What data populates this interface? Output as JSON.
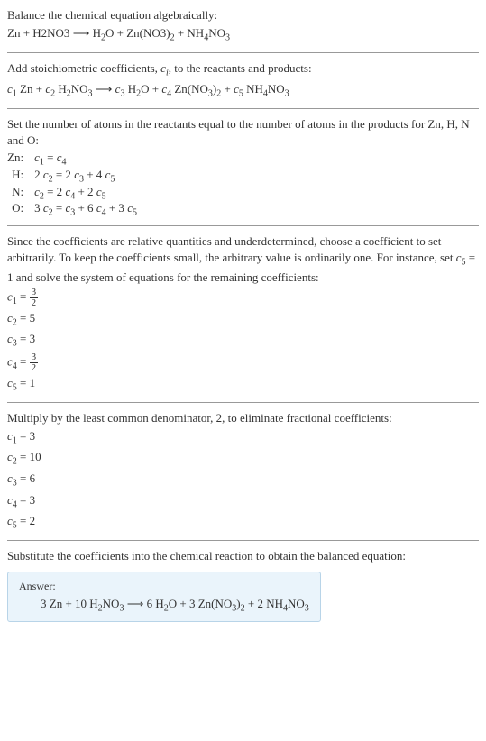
{
  "intro": {
    "line1": "Balance the chemical equation algebraically:"
  },
  "stoich": {
    "line1": "Add stoichiometric coefficients, ",
    "line1b": ", to the reactants and products:"
  },
  "atoms": {
    "line1": "Set the number of atoms in the reactants equal to the number of atoms in the products for Zn, H, N and O:",
    "rows": [
      {
        "label": "Zn:"
      },
      {
        "label": "H:"
      },
      {
        "label": "N:"
      },
      {
        "label": "O:"
      }
    ]
  },
  "choose": {
    "para": "Since the coefficients are relative quantities and underdetermined, choose a coefficient to set arbitrarily. To keep the coefficients small, the arbitrary value is ordinarily one. For instance, set ",
    "para2": " = 1 and solve the system of equations for the remaining coefficients:"
  },
  "multiply": {
    "line1": "Multiply by the least common denominator, 2, to eliminate fractional coefficients:"
  },
  "substitute": {
    "line1": "Substitute the coefficients into the chemical reaction to obtain the balanced equation:"
  },
  "answer": {
    "label": "Answer:"
  },
  "coeffs1": {
    "c1": " = ",
    "c2": " = 5",
    "c3": " = 3",
    "c4": " = ",
    "c5": " = 1"
  },
  "coeffs2": {
    "c1": " = 3",
    "c2": " = 10",
    "c3": " = 6",
    "c4": " = 3",
    "c5": " = 2"
  }
}
